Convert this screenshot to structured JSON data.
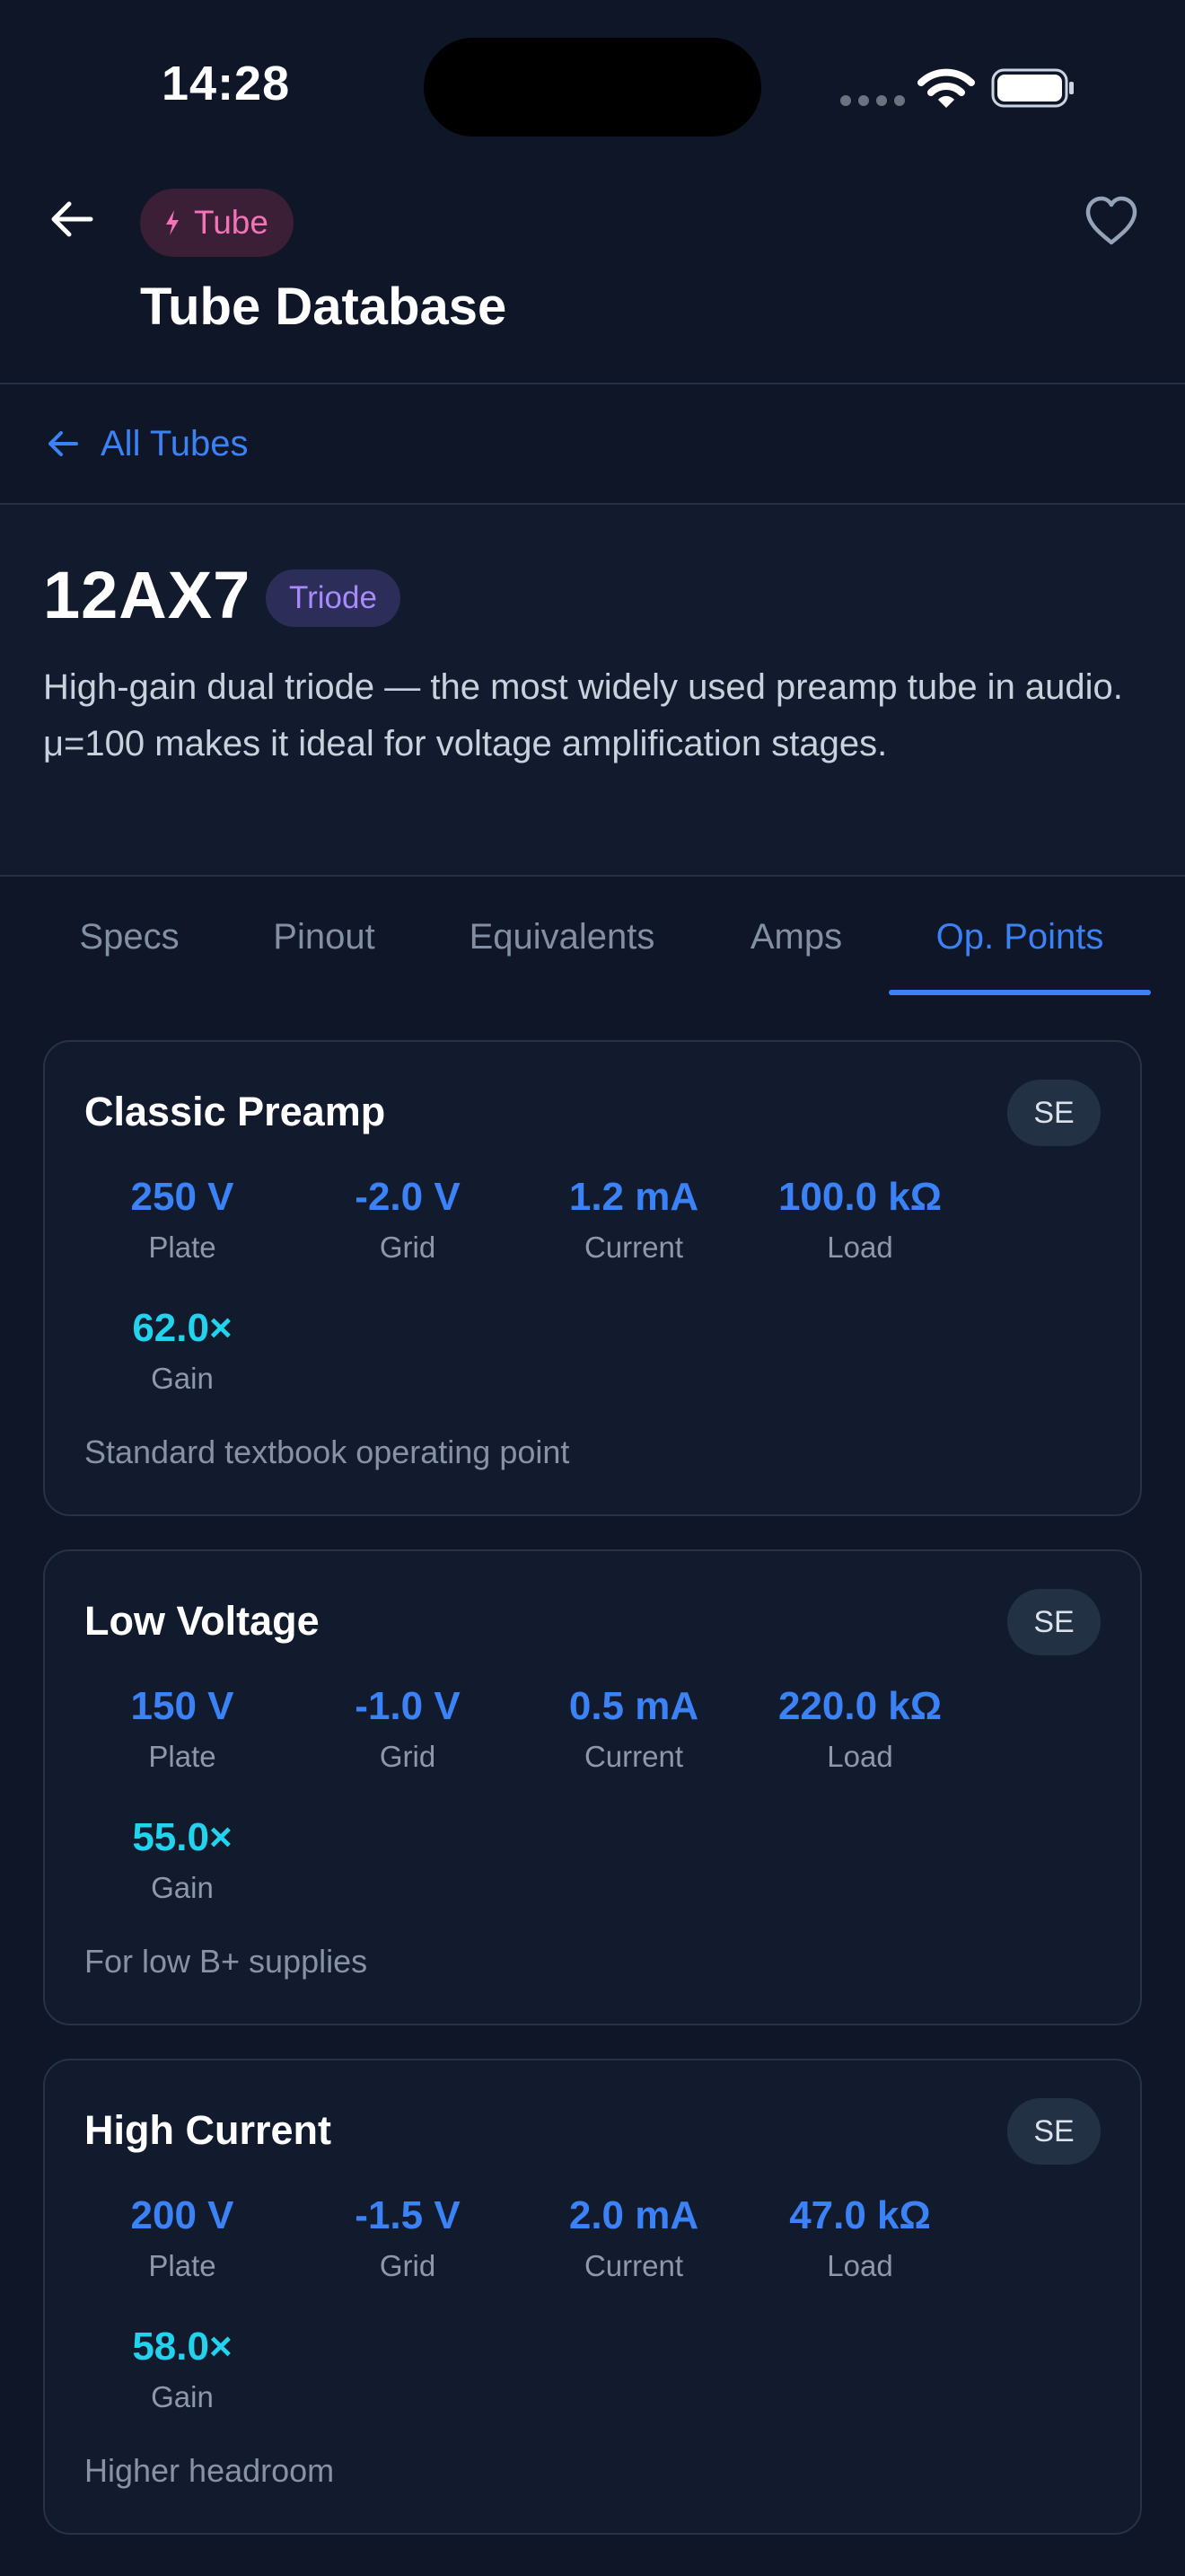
{
  "status_bar": {
    "time": "14:28"
  },
  "header": {
    "category_chip": "Tube",
    "title": "Tube Database"
  },
  "breadcrumb": {
    "label": "All Tubes"
  },
  "tube": {
    "name": "12AX7",
    "type_badge": "Triode",
    "description": "High-gain dual triode — the most widely used preamp tube in audio. μ=100 makes it ideal for voltage amplification stages."
  },
  "tabs": [
    {
      "label": "Specs"
    },
    {
      "label": "Pinout"
    },
    {
      "label": "Equivalents"
    },
    {
      "label": "Amps"
    },
    {
      "label": "Op. Points",
      "active": true
    }
  ],
  "labels": {
    "plate": "Plate",
    "grid": "Grid",
    "current": "Current",
    "load": "Load",
    "gain": "Gain"
  },
  "operating_points": [
    {
      "title": "Classic Preamp",
      "badge": "SE",
      "plate": "250 V",
      "grid": "-2.0 V",
      "current": "1.2 mA",
      "load": "100.0 kΩ",
      "gain": "62.0×",
      "note": "Standard textbook operating point"
    },
    {
      "title": "Low Voltage",
      "badge": "SE",
      "plate": "150 V",
      "grid": "-1.0 V",
      "current": "0.5 mA",
      "load": "220.0 kΩ",
      "gain": "55.0×",
      "note": "For low B+ supplies"
    },
    {
      "title": "High Current",
      "badge": "SE",
      "plate": "200 V",
      "grid": "-1.5 V",
      "current": "2.0 mA",
      "load": "47.0 kΩ",
      "gain": "58.0×",
      "note": "Higher headroom"
    }
  ],
  "colors": {
    "background": "#0e1628",
    "accent": "#3b82f6",
    "gain": "#22d3ee",
    "category": "#f472b6",
    "type_badge": "#a78bfa"
  }
}
